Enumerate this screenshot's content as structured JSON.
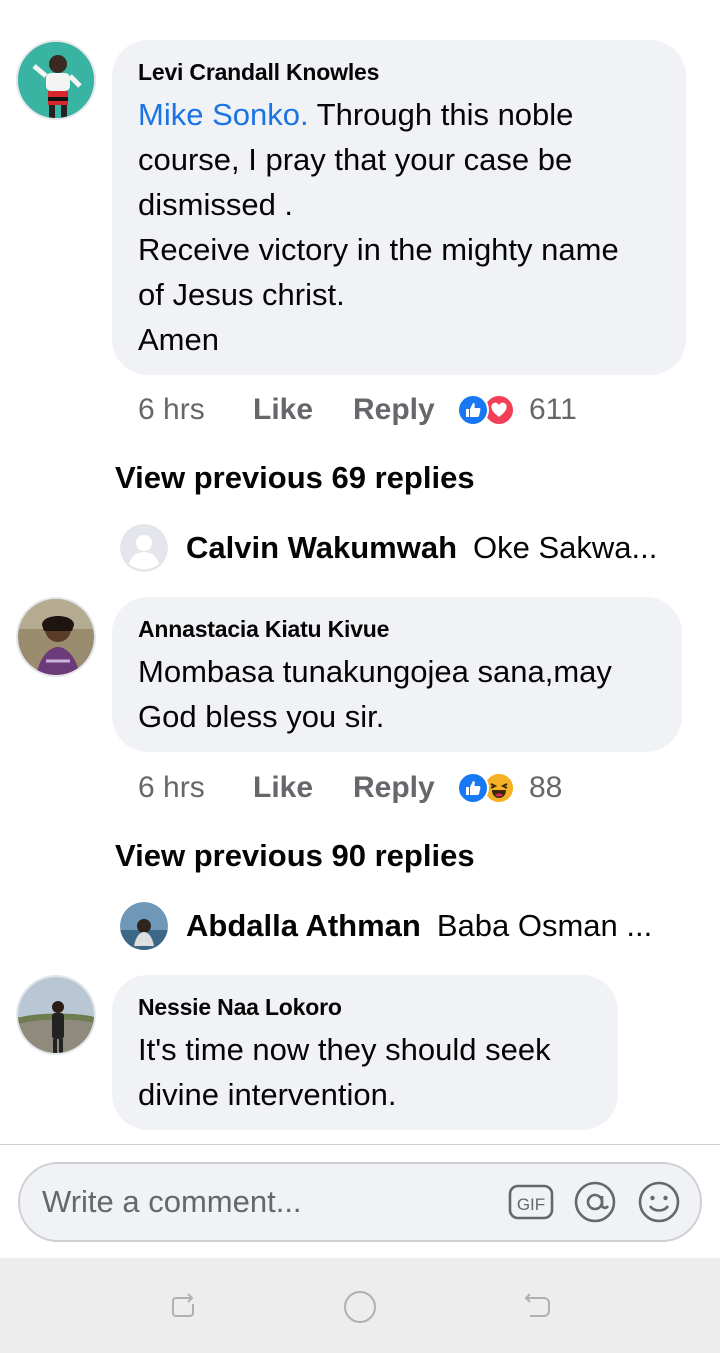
{
  "comments": [
    {
      "author": "Levi Crandall Knowles",
      "mention": "Mike Sonko.",
      "text": "Through this noble course, I pray that your case be dismissed .",
      "text_lines": [
        "Receive victory in the mighty name",
        "of Jesus christ.",
        "Amen"
      ],
      "time": "6 hrs",
      "like_label": "Like",
      "reply_label": "Reply",
      "reactions": [
        "like",
        "love"
      ],
      "reaction_count": "611",
      "view_previous": "View previous 69 replies",
      "latest_reply": {
        "author": "Calvin Wakumwah",
        "text": "Oke Sakwa..."
      }
    },
    {
      "author": "Annastacia Kiatu Kivue",
      "text_lines": [
        "Mombasa tunakungojea sana,may",
        "God bless you sir."
      ],
      "time": "6 hrs",
      "like_label": "Like",
      "reply_label": "Reply",
      "reactions": [
        "like",
        "haha"
      ],
      "reaction_count": "88",
      "view_previous": "View previous 90 replies",
      "latest_reply": {
        "author": "Abdalla Athman",
        "text": "Baba Osman ..."
      }
    },
    {
      "author": "Nessie Naa Lokoro",
      "text_lines": [
        "It's time now they should seek",
        "divine intervention."
      ]
    }
  ],
  "composer": {
    "placeholder": "Write a comment...",
    "icons": [
      "gif-icon",
      "at-mention-icon",
      "emoji-icon"
    ]
  },
  "navbar": {
    "icons": [
      "recent-apps-icon",
      "home-icon",
      "back-icon"
    ]
  },
  "colors": {
    "accent": "#1b74e4",
    "bubble": "#f0f2f5",
    "secondary_text": "#65676b",
    "like_blue": "#1877f2",
    "love_red": "#f33e58",
    "haha_yellow": "#f7b125"
  }
}
